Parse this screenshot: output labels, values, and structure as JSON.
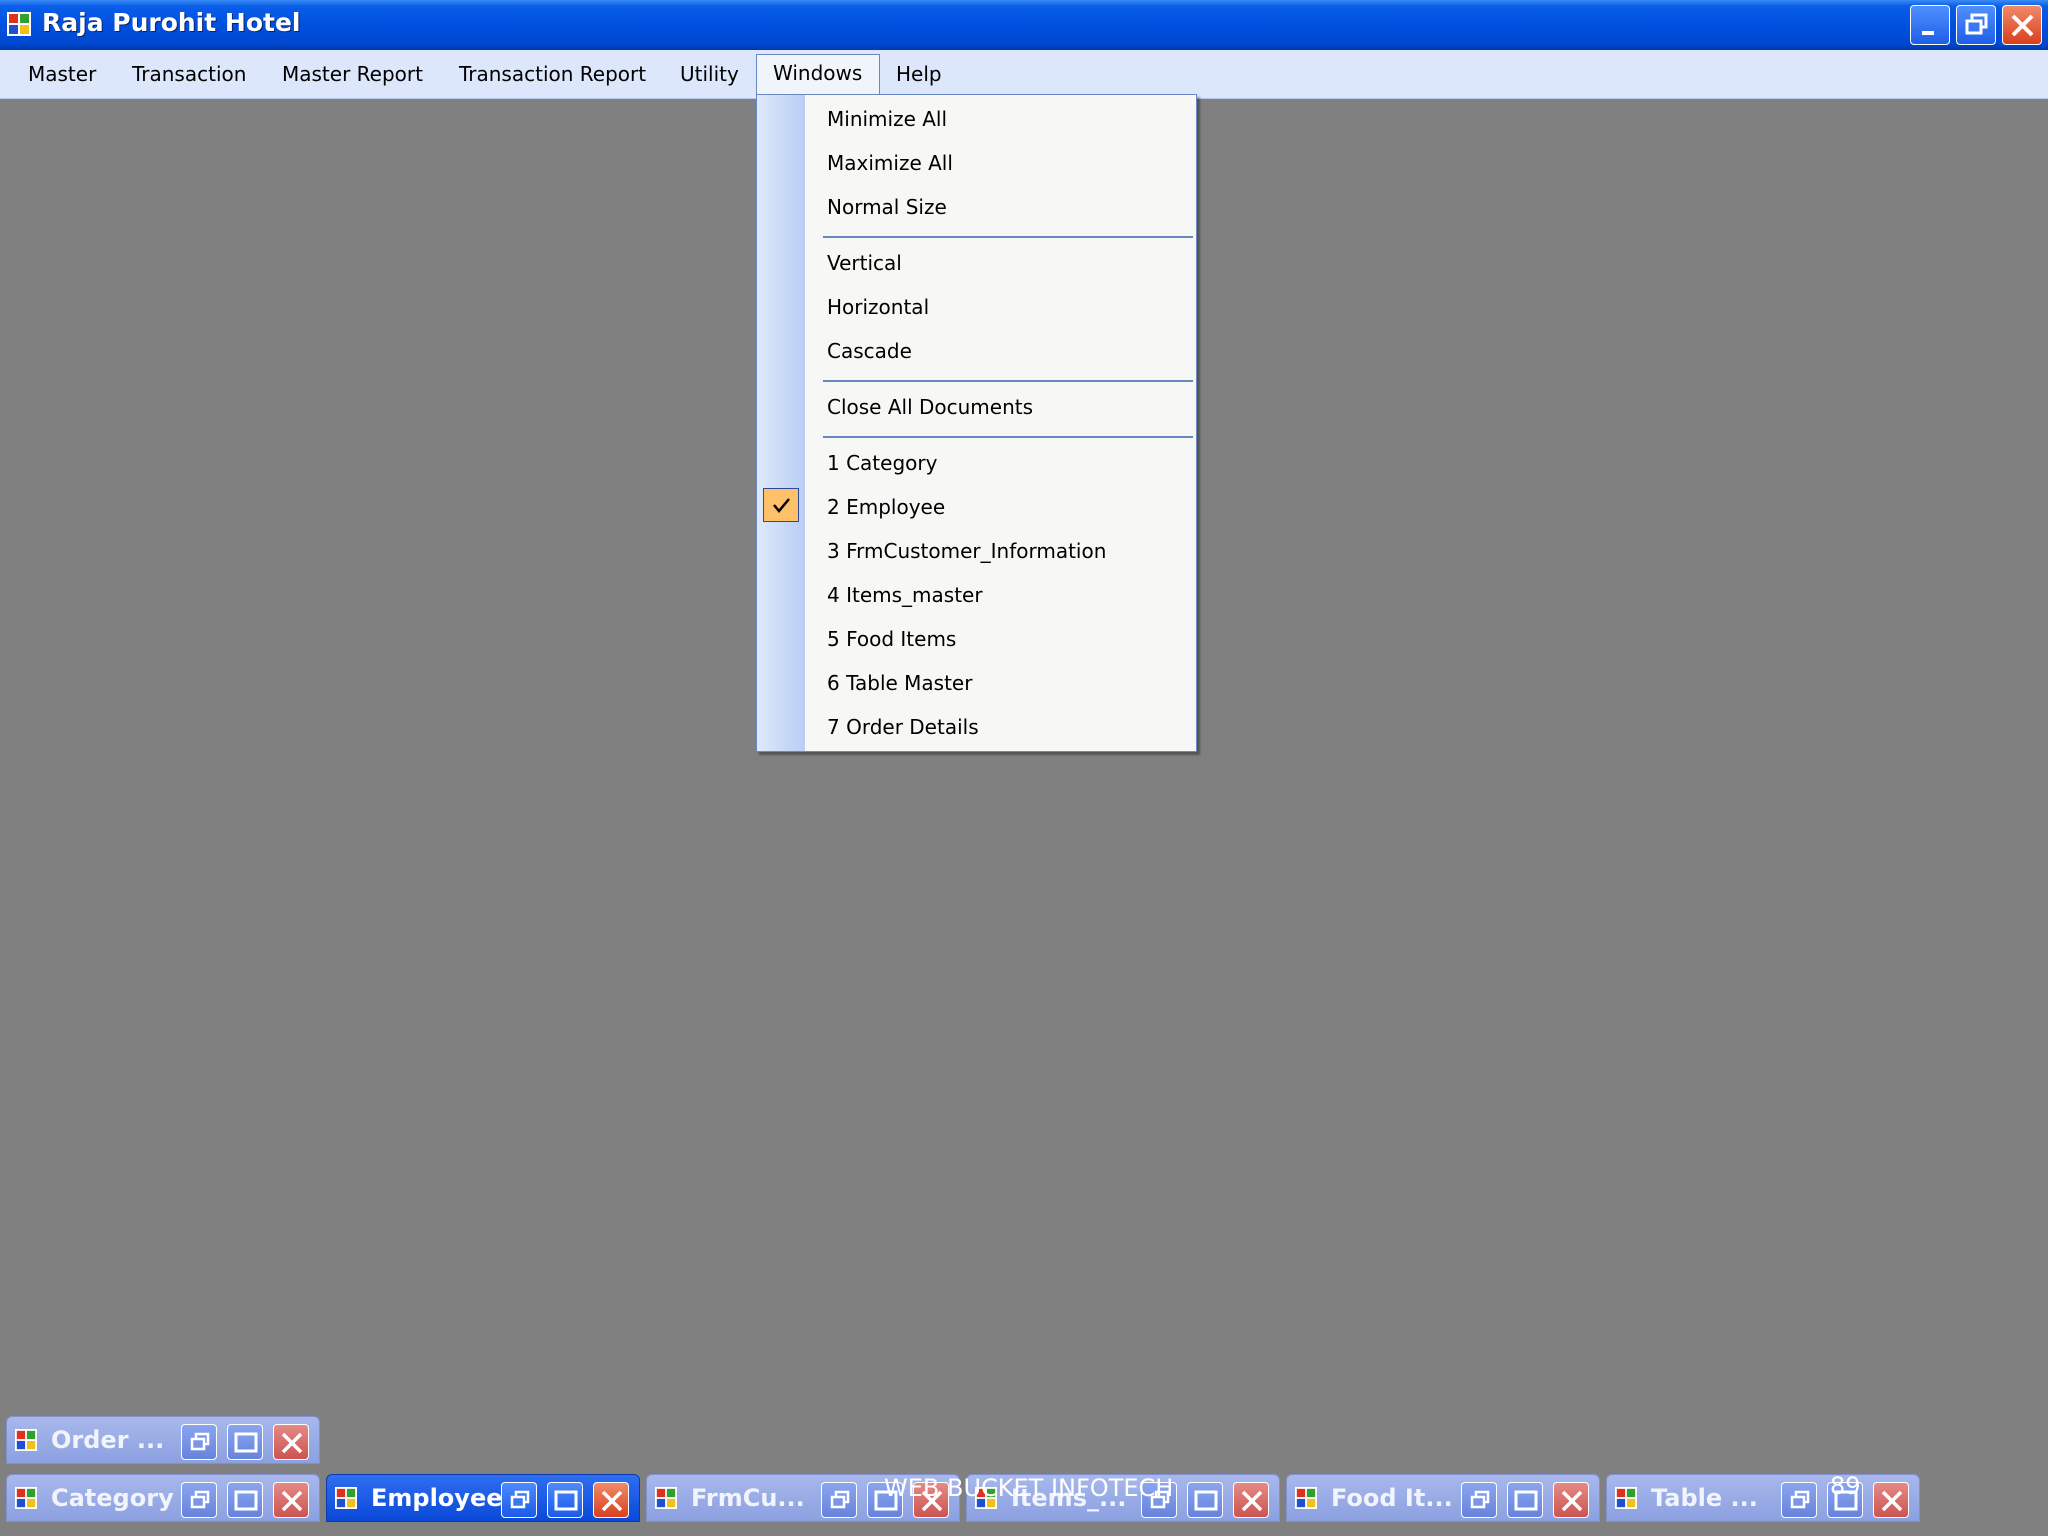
{
  "window": {
    "title": "Raja Purohit Hotel",
    "icon": "app-window-icon"
  },
  "menubar": {
    "items": [
      "Master",
      "Transaction",
      "Master Report",
      "Transaction Report",
      "Utility",
      "Windows",
      "Help"
    ],
    "open_menu": "Windows"
  },
  "windows_menu": {
    "items": [
      "Minimize All",
      "Maximize All",
      "Normal Size",
      "Vertical",
      "Horizontal",
      "Cascade",
      "Close All Documents",
      "1 Category",
      "2 Employee",
      "3 FrmCustomer_Information",
      "4 Items_master",
      "5 Food Items",
      "6 Table Master",
      "7 Order Details"
    ],
    "checked_item": "2 Employee"
  },
  "minimized_windows": {
    "top_row": [
      "Order ..."
    ],
    "bottom_row": [
      "Category",
      "Employee",
      "FrmCu...",
      "Items_...",
      "Food It...",
      "Table ..."
    ],
    "active": "Employee"
  },
  "overlay": {
    "watermark": "WEB BUCKET INFOTECH",
    "number": "89"
  },
  "colors": {
    "titlebar": "#0050e0",
    "menubar": "#dce7fb",
    "mdi_background": "#808080",
    "check_highlight": "#ffc06a"
  }
}
